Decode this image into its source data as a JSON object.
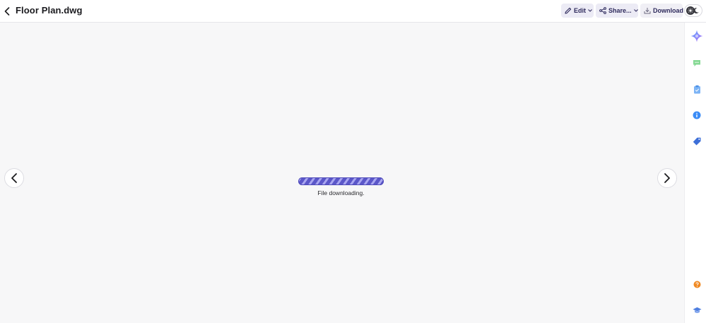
{
  "window": {
    "title": "Floor Plan.dwg"
  },
  "toolbar": {
    "back_icon": "chevron-left-icon",
    "edit_label": "Edit",
    "edit_icon": "pencil-icon",
    "share_label": "Share...",
    "share_icon": "share-icon",
    "download_label": "Download",
    "download_icon": "download-icon",
    "theme_toggle_icons": [
      "sun-icon",
      "moon-icon"
    ]
  },
  "viewer": {
    "prev_icon": "chevron-left-icon",
    "next_icon": "chevron-right-icon",
    "status_text": "File downloading.",
    "progress": 1.0,
    "progress_color": "#5b57c9"
  },
  "rail": {
    "items": [
      {
        "icon": "sparkle-icon",
        "color": "#7b7ff5"
      },
      {
        "icon": "comment-icon",
        "color": "#7bd389"
      },
      {
        "icon": "clipboard-icon",
        "color": "#6aa7f0"
      },
      {
        "icon": "info-icon",
        "color": "#3b82f6"
      },
      {
        "icon": "tag-icon",
        "color": "#3b6fd6"
      },
      {
        "icon": "help-icon",
        "color": "#f08a24"
      },
      {
        "icon": "graduation-cap-icon",
        "color": "#4f7fe0"
      }
    ]
  },
  "colors": {
    "accent": "#5b57c9",
    "button_bg": "#ecebf5",
    "button_text": "#2e2a5c"
  }
}
